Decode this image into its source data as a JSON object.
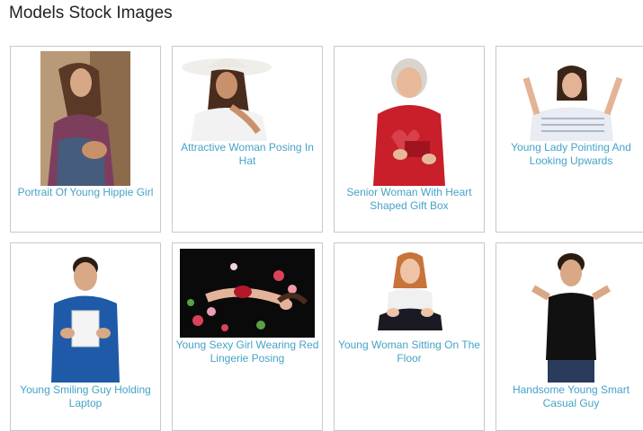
{
  "page": {
    "title": "Models Stock Images"
  },
  "gallery": {
    "items": [
      {
        "caption": "Portrait Of Young Hippie Girl",
        "icon": "hippie-girl-photo"
      },
      {
        "caption": "Attractive Woman Posing In Hat",
        "icon": "woman-in-hat-photo"
      },
      {
        "caption": "Senior Woman With Heart Shaped Gift Box",
        "icon": "senior-woman-gift-photo"
      },
      {
        "caption": "Young Lady Pointing And Looking Upwards",
        "icon": "lady-pointing-up-photo"
      },
      {
        "caption": "Young Smiling Guy Holding Laptop",
        "icon": "guy-with-laptop-photo"
      },
      {
        "caption": "Young Sexy Girl Wearing Red Lingerie Posing",
        "icon": "girl-in-flowers-photo"
      },
      {
        "caption": "Young Woman Sitting On The Floor",
        "icon": "woman-sitting-photo"
      },
      {
        "caption": "Handsome Young Smart Casual Guy",
        "icon": "casual-guy-photo"
      }
    ]
  },
  "colors": {
    "link": "#46a3c7",
    "border": "#c9c9c9"
  }
}
